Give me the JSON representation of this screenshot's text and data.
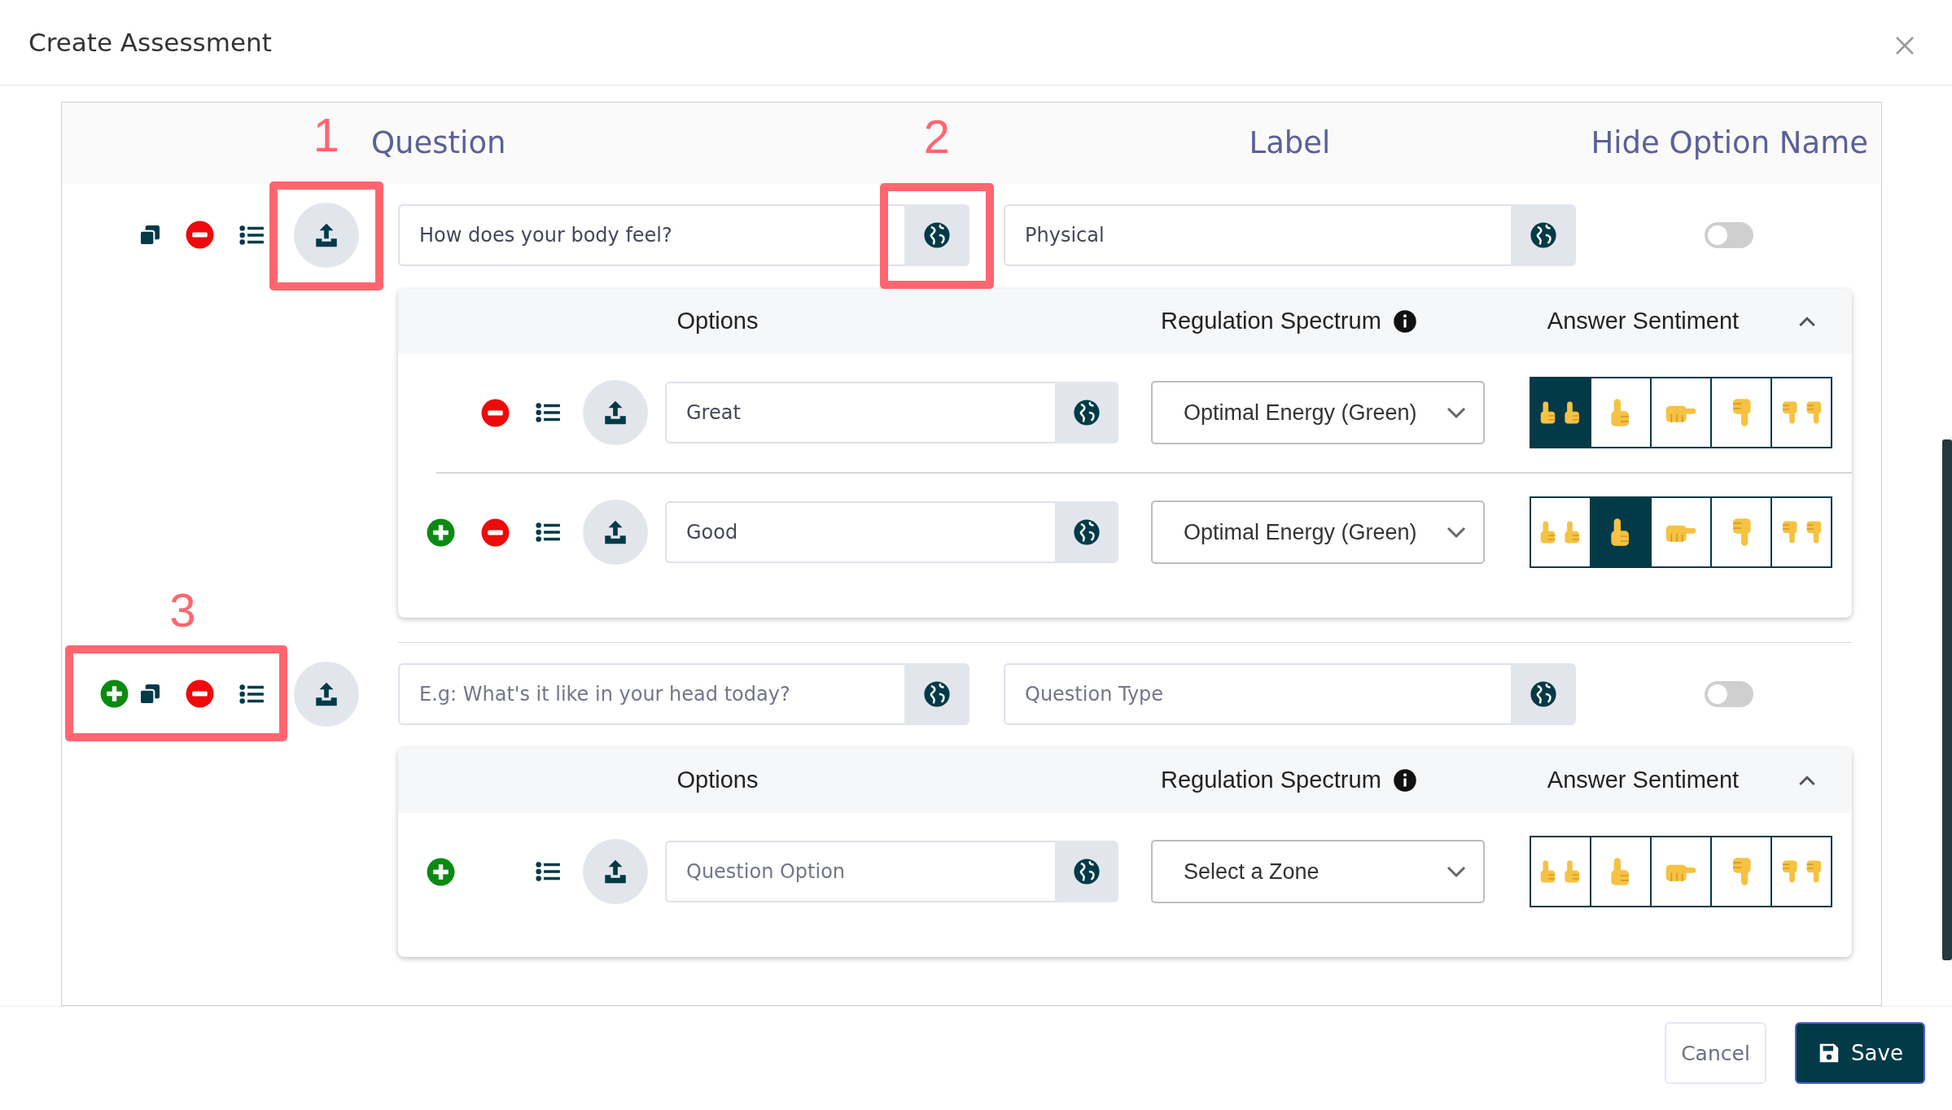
{
  "window": {
    "title": "Create Assessment"
  },
  "columns": [
    "Question",
    "Label",
    "Hide Option Name"
  ],
  "questions": [
    {
      "can_add": false,
      "annotations": [
        {
          "kind": "upload",
          "label": "1"
        },
        {
          "kind": "translate",
          "label": "2"
        }
      ],
      "question": {
        "value": "How does your body feel?"
      },
      "label": {
        "value": "Physical"
      },
      "hide_option_name": false,
      "options_panel": {
        "expanded": true,
        "headers": [
          "Options",
          "Regulation Spectrum",
          "Answer Sentiment"
        ],
        "options": [
          {
            "can_add": false,
            "can_remove": true,
            "text": {
              "value": "Great"
            },
            "zone": "Optimal Energy (Green)",
            "sentiments": [
              {
                "kind": "double_up",
                "selected": true
              },
              {
                "kind": "up",
                "selected": false
              },
              {
                "kind": "sideways",
                "selected": false
              },
              {
                "kind": "down",
                "selected": false
              },
              {
                "kind": "double_down",
                "selected": false
              }
            ]
          },
          {
            "can_add": true,
            "can_remove": true,
            "text": {
              "value": "Good"
            },
            "zone": "Optimal Energy (Green)",
            "sentiments": [
              {
                "kind": "double_up",
                "selected": false
              },
              {
                "kind": "up",
                "selected": true
              },
              {
                "kind": "sideways",
                "selected": false
              },
              {
                "kind": "down",
                "selected": false
              },
              {
                "kind": "double_down",
                "selected": false
              }
            ]
          }
        ]
      }
    },
    {
      "can_add": true,
      "annotations": [
        {
          "kind": "actions",
          "label": "3"
        }
      ],
      "question": {
        "placeholder": "E.g: What's it like in your head today?"
      },
      "label": {
        "placeholder": "Question Type"
      },
      "hide_option_name": false,
      "options_panel": {
        "expanded": true,
        "headers": [
          "Options",
          "Regulation Spectrum",
          "Answer Sentiment"
        ],
        "options": [
          {
            "can_add": true,
            "can_remove": false,
            "text": {
              "placeholder": "Question Option"
            },
            "zone": "Select a Zone",
            "sentiments": [
              {
                "kind": "double_up",
                "selected": false
              },
              {
                "kind": "up",
                "selected": false
              },
              {
                "kind": "sideways",
                "selected": false
              },
              {
                "kind": "down",
                "selected": false
              },
              {
                "kind": "double_down",
                "selected": false
              }
            ]
          }
        ]
      }
    }
  ],
  "buttons": [
    "Cancel",
    "Save"
  ]
}
